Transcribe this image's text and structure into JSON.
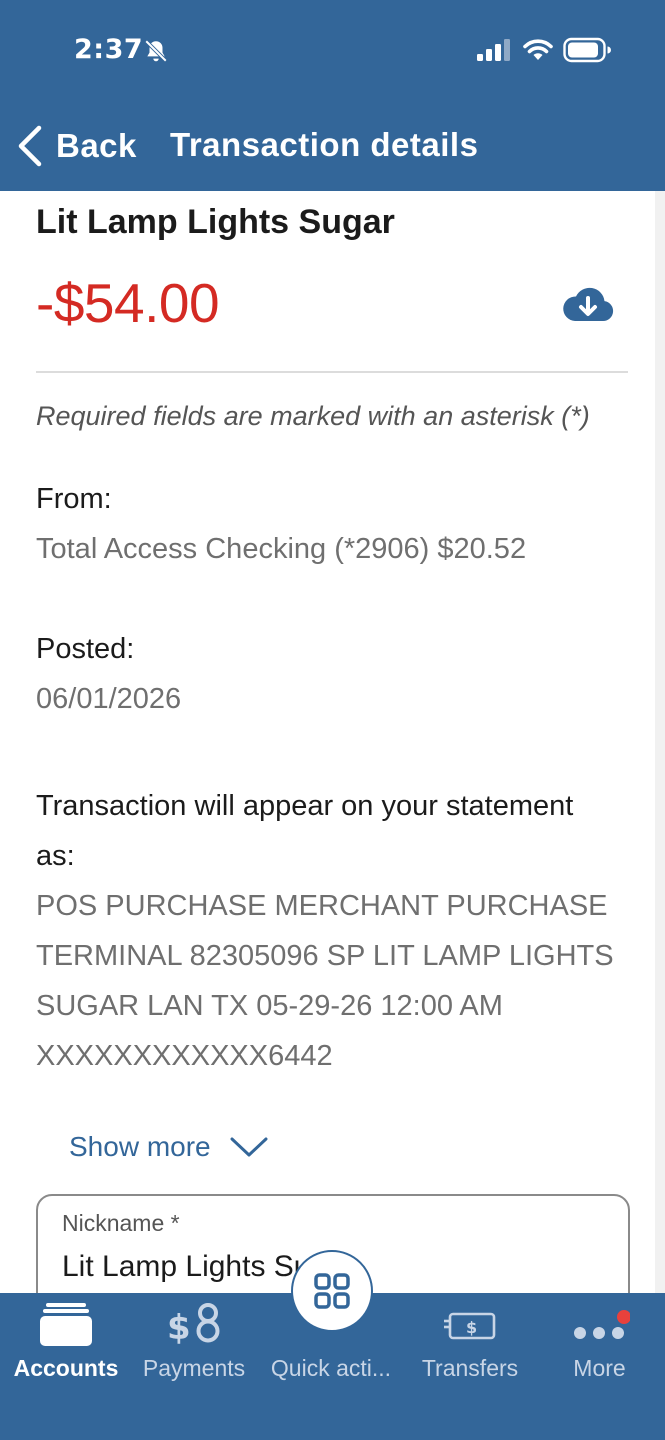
{
  "status": {
    "time": "2:37"
  },
  "nav": {
    "back_label": "Back",
    "title": "Transaction details"
  },
  "transaction": {
    "merchant": "Lit Lamp Lights Sugar",
    "amount": "-$54.00",
    "amount_color": "#d42a23",
    "required_note": "Required fields are marked with an asterisk (*)",
    "from_label": "From:",
    "from_value": "Total Access Checking (*2906) $20.52",
    "posted_label": "Posted:",
    "posted_value": "06/01/2026",
    "statement_label": "Transaction will appear on your statement as:",
    "statement_value": "POS PURCHASE MERCHANT PURCHASE TERMINAL 82305096 SP LIT LAMP LIGHTS SUGAR LAN TX 05-29-26 12:00 AM XXXXXXXXXXXX6442",
    "show_more_label": "Show more"
  },
  "nickname": {
    "label": "Nickname *",
    "value": "Lit Lamp Lights Sugar"
  },
  "tabs": [
    {
      "label": "Accounts",
      "icon": "wallet-icon",
      "active": true
    },
    {
      "label": "Payments",
      "icon": "dollar-icon",
      "active": false
    },
    {
      "label": "Quick acti...",
      "icon": "grid-icon",
      "active": false
    },
    {
      "label": "Transfers",
      "icon": "cash-icon",
      "active": false
    },
    {
      "label": "More",
      "icon": "dots-icon",
      "active": false
    }
  ],
  "colors": {
    "brand": "#336699",
    "notification_dot": "#e8413c"
  }
}
